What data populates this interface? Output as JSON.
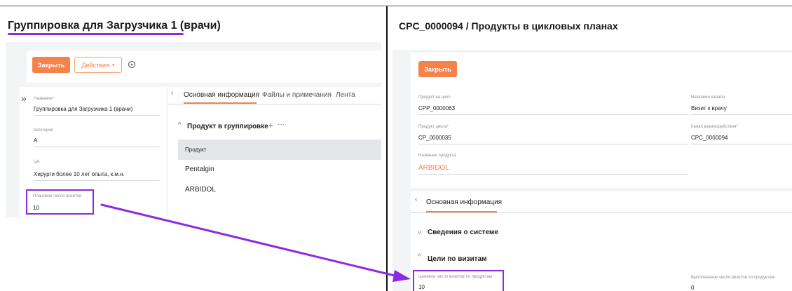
{
  "left": {
    "title": "Группировка для Загрузчика 1 (врачи)",
    "toolbar": {
      "close_label": "Закрыть",
      "actions_label": "Действия"
    },
    "fields": {
      "name_label": "Название",
      "name_value": "Группировка для Загрузчика 1 (врачи)",
      "category_label": "Категория",
      "category_value": "А",
      "ca_label": "ЦА",
      "ca_value": "Хирурги более 10 лет опыта, к.м.н.",
      "planned_label": "Плановое число визитов",
      "planned_value": "10"
    },
    "tabs": [
      "Основная информация",
      "Файлы и примечания",
      "Лента"
    ],
    "section_title": "Продукт в группировке",
    "table": {
      "header": "Продукт",
      "rows": [
        "Pentalgin",
        "ARBIDOL"
      ]
    }
  },
  "right": {
    "title": "CPC_0000094 / Продукты в цикловых планах",
    "toolbar": {
      "close_label": "Закрыть"
    },
    "fields": {
      "product_cycle_label": "Продукт на цикл",
      "product_cycle_value": "CPP_0000063",
      "channel_name_label": "Название канала",
      "channel_name_value": "Визит к врачу",
      "cycle_product_label": "Продукт цикла",
      "cycle_product_value": "CP_0000035",
      "interaction_channel_label": "Канал взаимодействия",
      "interaction_channel_value": "CPC_0000094",
      "product_name_label": "Название продукта",
      "product_name_value": "ARBIDOL"
    },
    "tabs": [
      "Основная информация"
    ],
    "sections": {
      "system": "Сведения о системе",
      "goals": "Цели по визитам"
    },
    "goals": {
      "target_label": "Целевое число визитов по продуктам",
      "target_value": "10",
      "done_label": "Выполненное число визитов по продуктам",
      "done_value": "0"
    }
  },
  "colors": {
    "accent": "#f4834b",
    "highlight": "#8b2be2",
    "panel": "#f3f4f6"
  }
}
